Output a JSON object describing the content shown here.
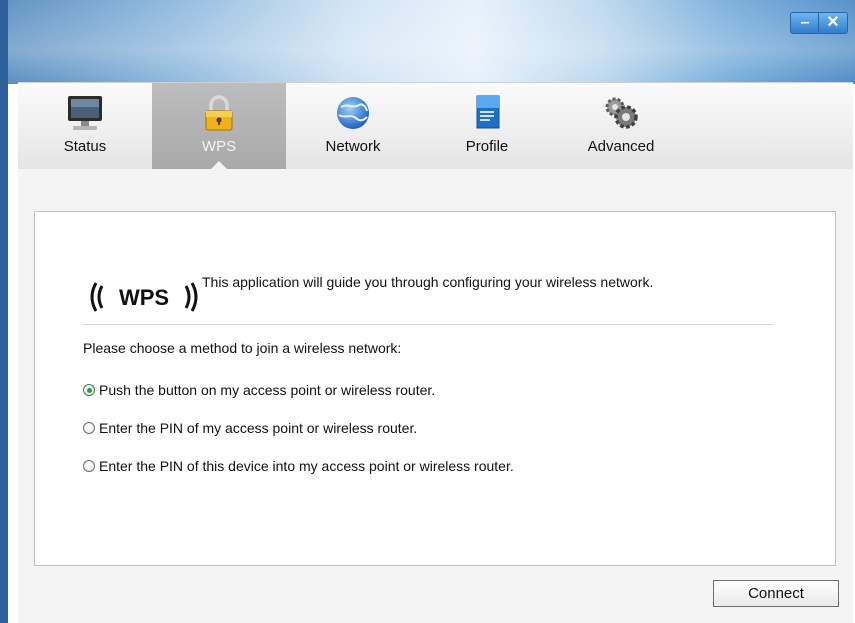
{
  "window": {
    "minimize_glyph": "–",
    "close_glyph": "✕"
  },
  "tabs": [
    {
      "label": "Status",
      "icon": "monitor-icon",
      "active": false
    },
    {
      "label": "WPS",
      "icon": "padlock-icon",
      "active": true
    },
    {
      "label": "Network",
      "icon": "globe-icon",
      "active": false
    },
    {
      "label": "Profile",
      "icon": "profile-document-icon",
      "active": false
    },
    {
      "label": "Advanced",
      "icon": "gears-icon",
      "active": false
    }
  ],
  "wps": {
    "logo_text": "WPS",
    "intro": "This application will guide you through configuring your wireless network.",
    "prompt": "Please choose a method to join a wireless network:",
    "options": [
      {
        "label": "Push the button on my access point or wireless router.",
        "selected": true
      },
      {
        "label": "Enter the PIN of my access point or wireless router.",
        "selected": false
      },
      {
        "label": "Enter the PIN of this device into my access point or wireless router.",
        "selected": false
      }
    ],
    "connect_label": "Connect"
  },
  "colors": {
    "accent_blue": "#2f7ed0",
    "active_tab": "#ababab",
    "radio_selected": "#2e9c3a"
  }
}
